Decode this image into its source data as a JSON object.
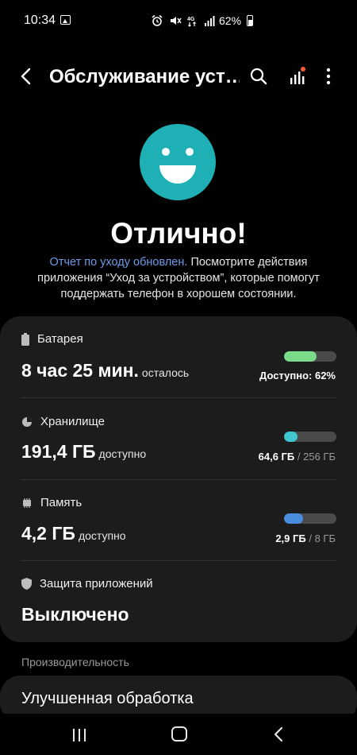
{
  "status_bar": {
    "time": "10:34",
    "battery_pct": "62%"
  },
  "app_bar": {
    "title": "Обслуживание уст…"
  },
  "hero": {
    "status": "Отлично!",
    "link_text": "Отчет по уходу обновлен.",
    "description": " Посмотрите действия приложения “Уход за устройством”, которые помогут поддержать телефон в хорошем состоянии.",
    "face_color": "#1eb0b4"
  },
  "battery": {
    "label": "Батарея",
    "value": "8 час 25 мин.",
    "suffix": "осталось",
    "right": "Доступно: 62%",
    "fill": 0.62,
    "color": "#7adb8a"
  },
  "storage": {
    "label": "Хранилище",
    "value": "191,4 ГБ",
    "suffix": "доступно",
    "used": "64,6 ГБ",
    "total": "/ 256 ГБ",
    "fill": 0.25,
    "color": "#3fc6cf"
  },
  "memory": {
    "label": "Память",
    "value": "4,2 ГБ",
    "suffix": "доступно",
    "used": "2,9 ГБ",
    "total": "/ 8 ГБ",
    "fill": 0.36,
    "color": "#4a8ddf"
  },
  "protection": {
    "label": "Защита приложений",
    "value": "Выключено"
  },
  "performance": {
    "section_label": "Производительность",
    "item_title": "Улучшенная обработка"
  }
}
